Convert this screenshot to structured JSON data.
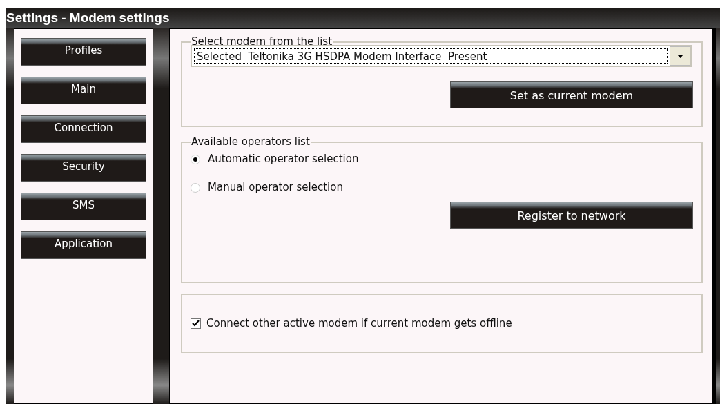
{
  "window": {
    "title": "Settings - Modem settings"
  },
  "sidebar": {
    "items": [
      {
        "label": "Profiles"
      },
      {
        "label": "Main"
      },
      {
        "label": "Connection"
      },
      {
        "label": "Security"
      },
      {
        "label": "SMS"
      },
      {
        "label": "Application"
      }
    ]
  },
  "modem_group": {
    "legend": "Select modem from the list",
    "dropdown_value": "Selected  Teltonika 3G HSDPA Modem Interface  Present",
    "button": "Set as current modem"
  },
  "operators_group": {
    "legend": "Available operators list",
    "options": [
      {
        "label": "Automatic operator selection",
        "selected": true
      },
      {
        "label": "Manual operator selection",
        "selected": false
      }
    ],
    "button": "Register to network"
  },
  "failover": {
    "label": "Connect other active modem if current modem gets offline",
    "checked": true
  }
}
